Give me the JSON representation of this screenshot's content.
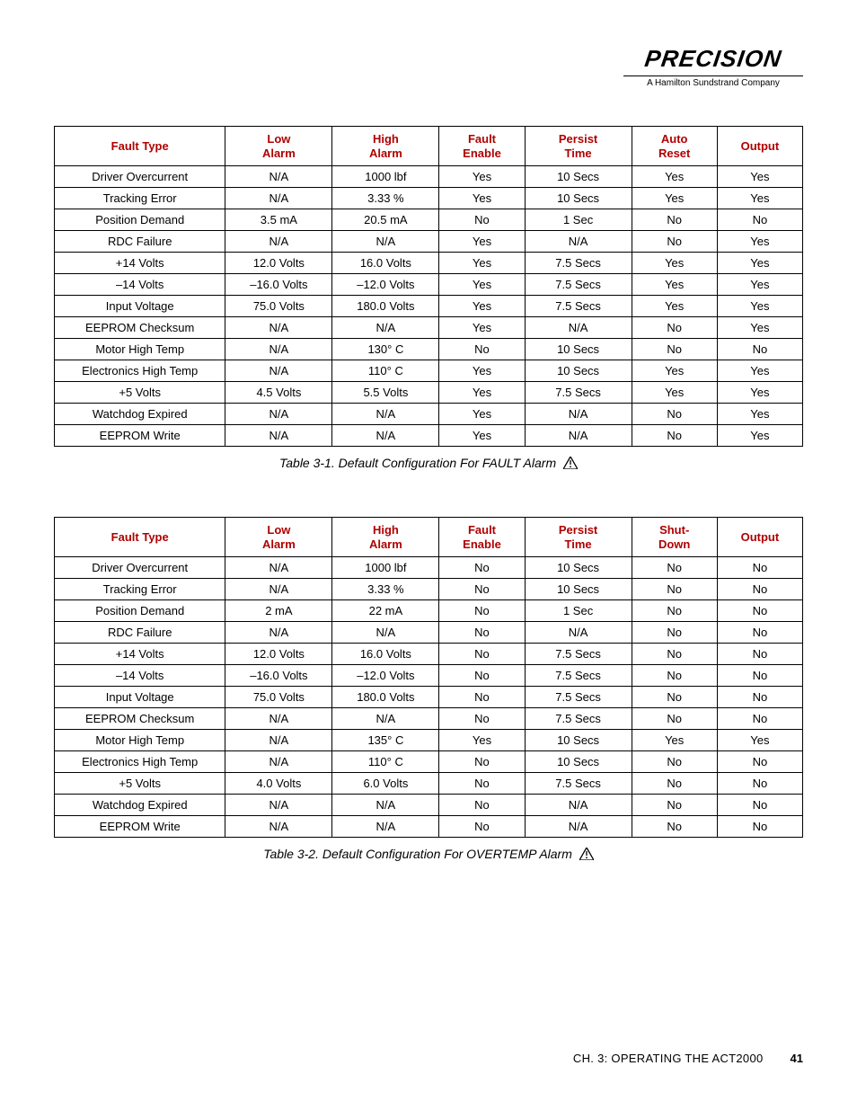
{
  "brand": {
    "name": "PRECISION",
    "sub": "A Hamilton Sundstrand Company"
  },
  "table1": {
    "headers": [
      "Fault Type",
      "Low Alarm",
      "High Alarm",
      "Fault Enable",
      "Persist Time",
      "Auto Reset",
      "Output"
    ],
    "rows": [
      [
        "Driver Overcurrent",
        "N/A",
        "1000 lbf",
        "Yes",
        "10 Secs",
        "Yes",
        "Yes"
      ],
      [
        "Tracking Error",
        "N/A",
        "3.33 %",
        "Yes",
        "10 Secs",
        "Yes",
        "Yes"
      ],
      [
        "Position Demand",
        "3.5 mA",
        "20.5 mA",
        "No",
        "1 Sec",
        "No",
        "No"
      ],
      [
        "RDC Failure",
        "N/A",
        "N/A",
        "Yes",
        "N/A",
        "No",
        "Yes"
      ],
      [
        "+14 Volts",
        "12.0 Volts",
        "16.0 Volts",
        "Yes",
        "7.5 Secs",
        "Yes",
        "Yes"
      ],
      [
        "–14 Volts",
        "–16.0 Volts",
        "–12.0 Volts",
        "Yes",
        "7.5 Secs",
        "Yes",
        "Yes"
      ],
      [
        "Input Voltage",
        "75.0 Volts",
        "180.0 Volts",
        "Yes",
        "7.5 Secs",
        "Yes",
        "Yes"
      ],
      [
        "EEPROM Checksum",
        "N/A",
        "N/A",
        "Yes",
        "N/A",
        "No",
        "Yes"
      ],
      [
        "Motor High Temp",
        "N/A",
        "130° C",
        "No",
        "10 Secs",
        "No",
        "No"
      ],
      [
        "Electronics High Temp",
        "N/A",
        "110° C",
        "Yes",
        "10 Secs",
        "Yes",
        "Yes"
      ],
      [
        "+5 Volts",
        "4.5 Volts",
        "5.5 Volts",
        "Yes",
        "7.5 Secs",
        "Yes",
        "Yes"
      ],
      [
        "Watchdog Expired",
        "N/A",
        "N/A",
        "Yes",
        "N/A",
        "No",
        "Yes"
      ],
      [
        "EEPROM Write",
        "N/A",
        "N/A",
        "Yes",
        "N/A",
        "No",
        "Yes"
      ]
    ],
    "caption": "Table 3-1.  Default Configuration For FAULT Alarm"
  },
  "table2": {
    "headers": [
      "Fault Type",
      "Low Alarm",
      "High Alarm",
      "Fault Enable",
      "Persist Time",
      "Shut-Down",
      "Output"
    ],
    "rows": [
      [
        "Driver Overcurrent",
        "N/A",
        "1000 lbf",
        "No",
        "10 Secs",
        "No",
        "No"
      ],
      [
        "Tracking Error",
        "N/A",
        "3.33 %",
        "No",
        "10 Secs",
        "No",
        "No"
      ],
      [
        "Position Demand",
        "2 mA",
        "22 mA",
        "No",
        "1 Sec",
        "No",
        "No"
      ],
      [
        "RDC Failure",
        "N/A",
        "N/A",
        "No",
        "N/A",
        "No",
        "No"
      ],
      [
        "+14 Volts",
        "12.0 Volts",
        "16.0 Volts",
        "No",
        "7.5 Secs",
        "No",
        "No"
      ],
      [
        "–14 Volts",
        "–16.0 Volts",
        "–12.0 Volts",
        "No",
        "7.5 Secs",
        "No",
        "No"
      ],
      [
        "Input Voltage",
        "75.0 Volts",
        "180.0 Volts",
        "No",
        "7.5 Secs",
        "No",
        "No"
      ],
      [
        "EEPROM Checksum",
        "N/A",
        "N/A",
        "No",
        "7.5 Secs",
        "No",
        "No"
      ],
      [
        "Motor High Temp",
        "N/A",
        "135° C",
        "Yes",
        "10 Secs",
        "Yes",
        "Yes"
      ],
      [
        "Electronics High Temp",
        "N/A",
        "110° C",
        "No",
        "10 Secs",
        "No",
        "No"
      ],
      [
        "+5 Volts",
        "4.0 Volts",
        "6.0 Volts",
        "No",
        "7.5 Secs",
        "No",
        "No"
      ],
      [
        "Watchdog Expired",
        "N/A",
        "N/A",
        "No",
        "N/A",
        "No",
        "No"
      ],
      [
        "EEPROM Write",
        "N/A",
        "N/A",
        "No",
        "N/A",
        "No",
        "No"
      ]
    ],
    "caption": "Table 3-2.  Default Configuration For OVERTEMP Alarm"
  },
  "footer": {
    "chapter": "CH. 3: OPERATING THE ACT2000",
    "page": "41"
  }
}
